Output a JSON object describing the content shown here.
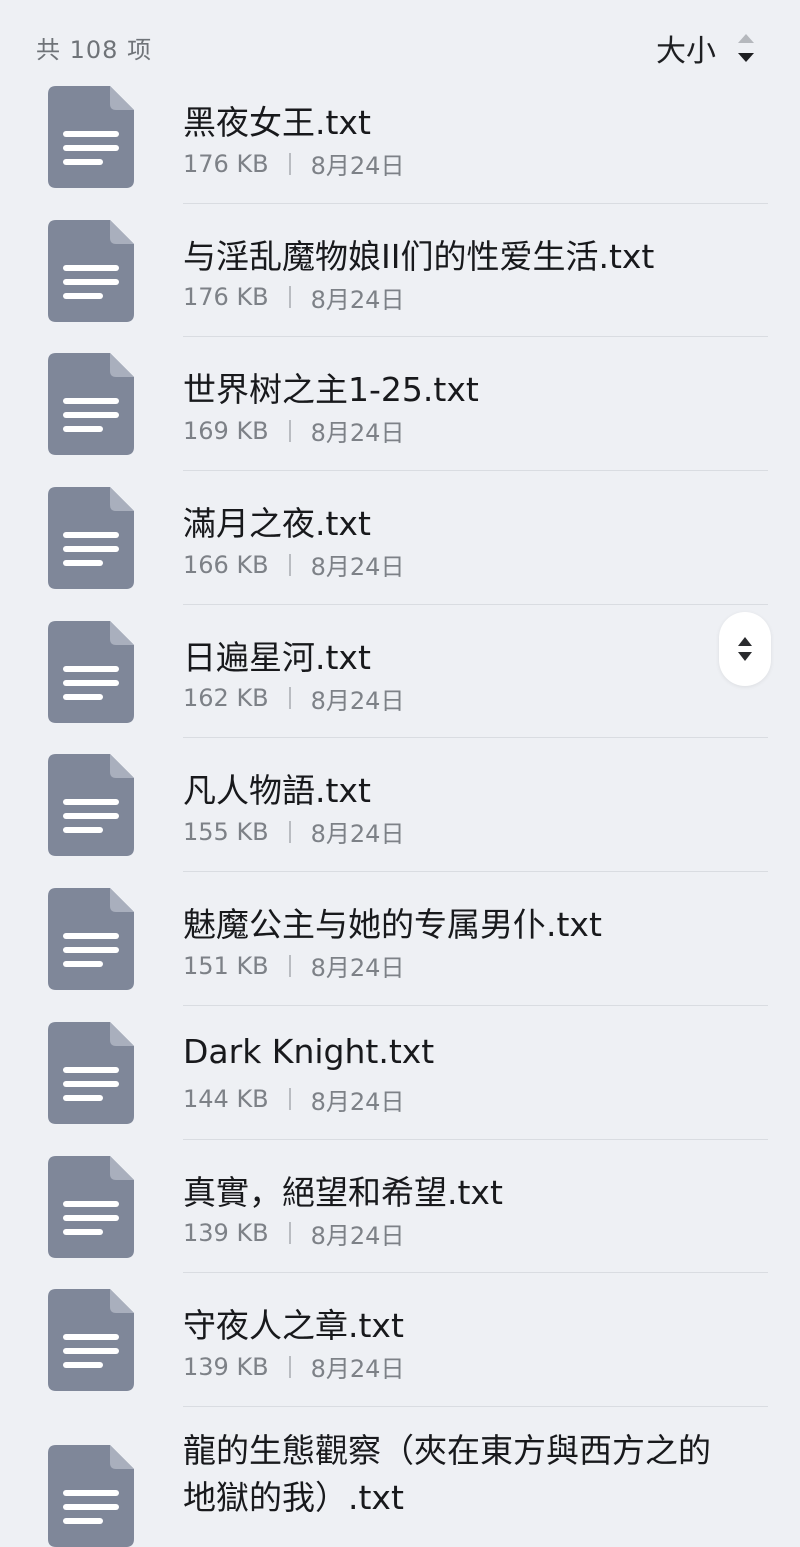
{
  "header": {
    "count_label": "共 108 项",
    "sort_label": "大小"
  },
  "colors": {
    "background": "#eef0f4",
    "file_icon": "#7f8799",
    "text_primary": "#18191c",
    "text_secondary": "#7d8187"
  },
  "icons": {
    "file": "document-icon",
    "sort": "sort-arrows-icon",
    "scroll": "fast-scroll-icon"
  },
  "files": [
    {
      "name": "黑夜女王.txt",
      "size": "176 KB",
      "date": "8月24日"
    },
    {
      "name": "与淫乱魔物娘II们的性爱生活.txt",
      "size": "176 KB",
      "date": "8月24日"
    },
    {
      "name": "世界树之主1-25.txt",
      "size": "169 KB",
      "date": "8月24日"
    },
    {
      "name": "滿月之夜.txt",
      "size": "166 KB",
      "date": "8月24日"
    },
    {
      "name": "日遍星河.txt",
      "size": "162 KB",
      "date": "8月24日"
    },
    {
      "name": "凡人物語.txt",
      "size": "155 KB",
      "date": "8月24日"
    },
    {
      "name": "魅魔公主与她的专属男仆.txt",
      "size": "151 KB",
      "date": "8月24日"
    },
    {
      "name": "Dark Knight.txt",
      "size": "144 KB",
      "date": "8月24日"
    },
    {
      "name": "真實，絕望和希望.txt",
      "size": "139 KB",
      "date": "8月24日"
    },
    {
      "name": "守夜人之章.txt",
      "size": "139 KB",
      "date": "8月24日"
    },
    {
      "name": "龍的生態觀察（夾在東方與西方之的地獄的我）.txt",
      "size": "",
      "date": ""
    }
  ]
}
